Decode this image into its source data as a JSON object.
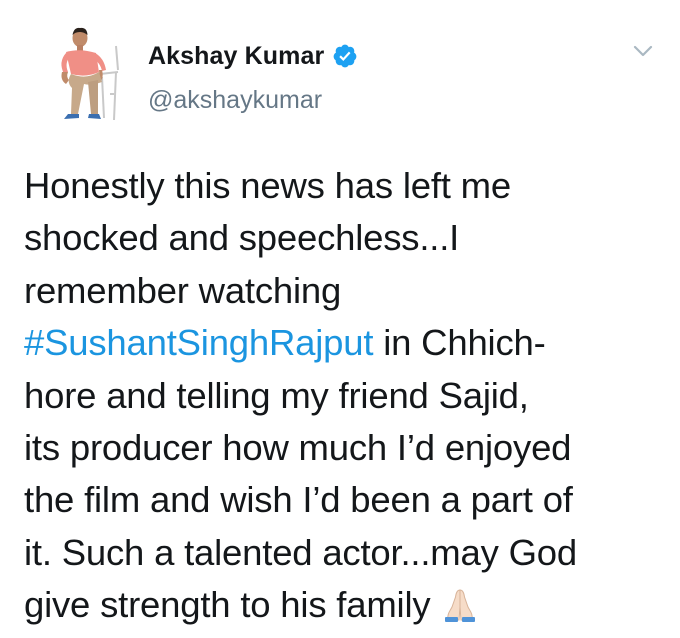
{
  "author": {
    "display_name": "Akshay Kumar",
    "handle": "@akshaykumar",
    "verified": true
  },
  "icons": {
    "verified": "verified-badge-icon",
    "caret": "chevron-down-icon",
    "emoji": "folded-hands-emoji-icon"
  },
  "colors": {
    "text": "#14171a",
    "secondary": "#657786",
    "hashtag": "#1b95e0",
    "verified": "#1da1f2"
  },
  "tweet": {
    "lines": [
      "Honestly this news has left me",
      "shocked and speechless...I",
      "remember watching",
      " in Chhich-",
      "hore and telling my friend Sajid,",
      "its producer how much I’d enjoyed",
      "the film and wish I’d been a part of",
      "it. Such a talented actor...may God",
      "give strength to his family"
    ],
    "hashtag": "#SushantSinghRajput"
  }
}
